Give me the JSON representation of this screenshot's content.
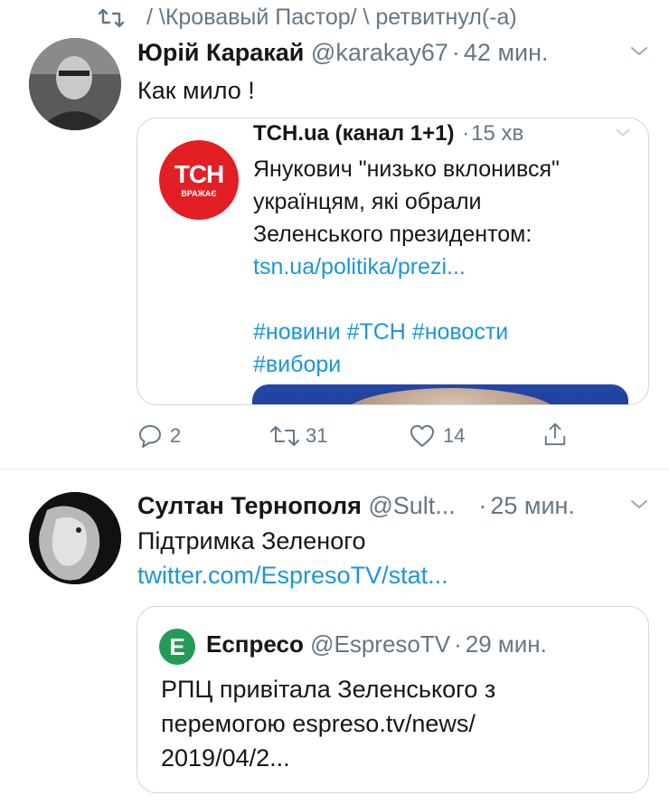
{
  "retweet": {
    "icon": "retweet-icon",
    "text": "/ \\Кровавый Пастор/ \\ ретвитнул(-а)"
  },
  "tweets": [
    {
      "name": "Юрій Каракай",
      "handle": "@karakay67",
      "sep": "·",
      "time": "42 мин.",
      "text": "Как мило !",
      "quoted": {
        "avatar_text": "ТСН",
        "avatar_sub": "ВРАЖАЄ",
        "name": "ТСН.ua (канал 1+1)",
        "sep": "·",
        "time": "15 хв",
        "lines": [
          "Янукович \"низько вклонився\"",
          "українцям, які обрали",
          "Зеленського президентом:"
        ],
        "link": "tsn.ua/politika/prezi...",
        "hashtags_line1": "#новини #ТСН #новости",
        "hashtags_line2": "#вибори"
      },
      "actions": {
        "reply_count": "2",
        "retweet_count": "31",
        "like_count": "14"
      }
    },
    {
      "name": "Султан Тернополя",
      "handle": "@Sult...",
      "sep": "·",
      "time": "25 мин.",
      "text": "Підтримка Зеленого",
      "link": "twitter.com/EspresoTV/stat...",
      "quoted": {
        "avatar_text": "Е",
        "name": "Еспресо",
        "handle": "@EspresoTV",
        "sep": "·",
        "time": "29 мин.",
        "lines": [
          "РПЦ привітала Зеленського з",
          "перемогою espreso.tv/news/",
          "2019/04/2..."
        ]
      }
    }
  ],
  "colors": {
    "link": "#1b95e0",
    "secondary": "#657786",
    "tsn_red": "#e31e24",
    "espreso_green": "#239b57"
  }
}
